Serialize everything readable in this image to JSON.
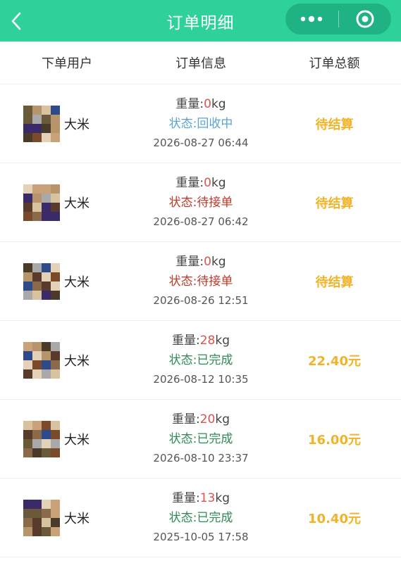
{
  "nav": {
    "title": "订单明细"
  },
  "table": {
    "headers": {
      "user": "下单用户",
      "info": "订单信息",
      "total": "订单总额"
    }
  },
  "orders": [
    {
      "user": "大米",
      "weight_label": "重量:",
      "weight": "0",
      "unit": "kg",
      "status": "状态:回收中",
      "status_color": "#5aa3d6",
      "time": "2026-08-27 06:44",
      "total": "待结算"
    },
    {
      "user": "大米",
      "weight_label": "重量:",
      "weight": "0",
      "unit": "kg",
      "status": "状态:待接单",
      "status_color": "#c0392b",
      "time": "2026-08-27 06:42",
      "total": "待结算"
    },
    {
      "user": "大米",
      "weight_label": "重量:",
      "weight": "0",
      "unit": "kg",
      "status": "状态:待接单",
      "status_color": "#c0392b",
      "time": "2026-08-26 12:51",
      "total": "待结算"
    },
    {
      "user": "大米",
      "weight_label": "重量:",
      "weight": "28",
      "unit": "kg",
      "status": "状态:已完成",
      "status_color": "#2e8b57",
      "time": "2026-08-12 10:35",
      "total": "22.40元"
    },
    {
      "user": "大米",
      "weight_label": "重量:",
      "weight": "20",
      "unit": "kg",
      "status": "状态:已完成",
      "status_color": "#2e8b57",
      "time": "2026-08-10 23:37",
      "total": "16.00元"
    },
    {
      "user": "大米",
      "weight_label": "重量:",
      "weight": "13",
      "unit": "kg",
      "status": "状态:已完成",
      "status_color": "#2e8b57",
      "time": "2025-10-05 17:58",
      "total": "10.40元"
    }
  ],
  "colors": {
    "nav_bg": "#2fd19a",
    "weight_number": "#d9534f",
    "total": "#f0b429"
  },
  "icons": {
    "back": "chevron-left-icon",
    "more": "more-dots-icon",
    "close": "target-circle-icon"
  }
}
